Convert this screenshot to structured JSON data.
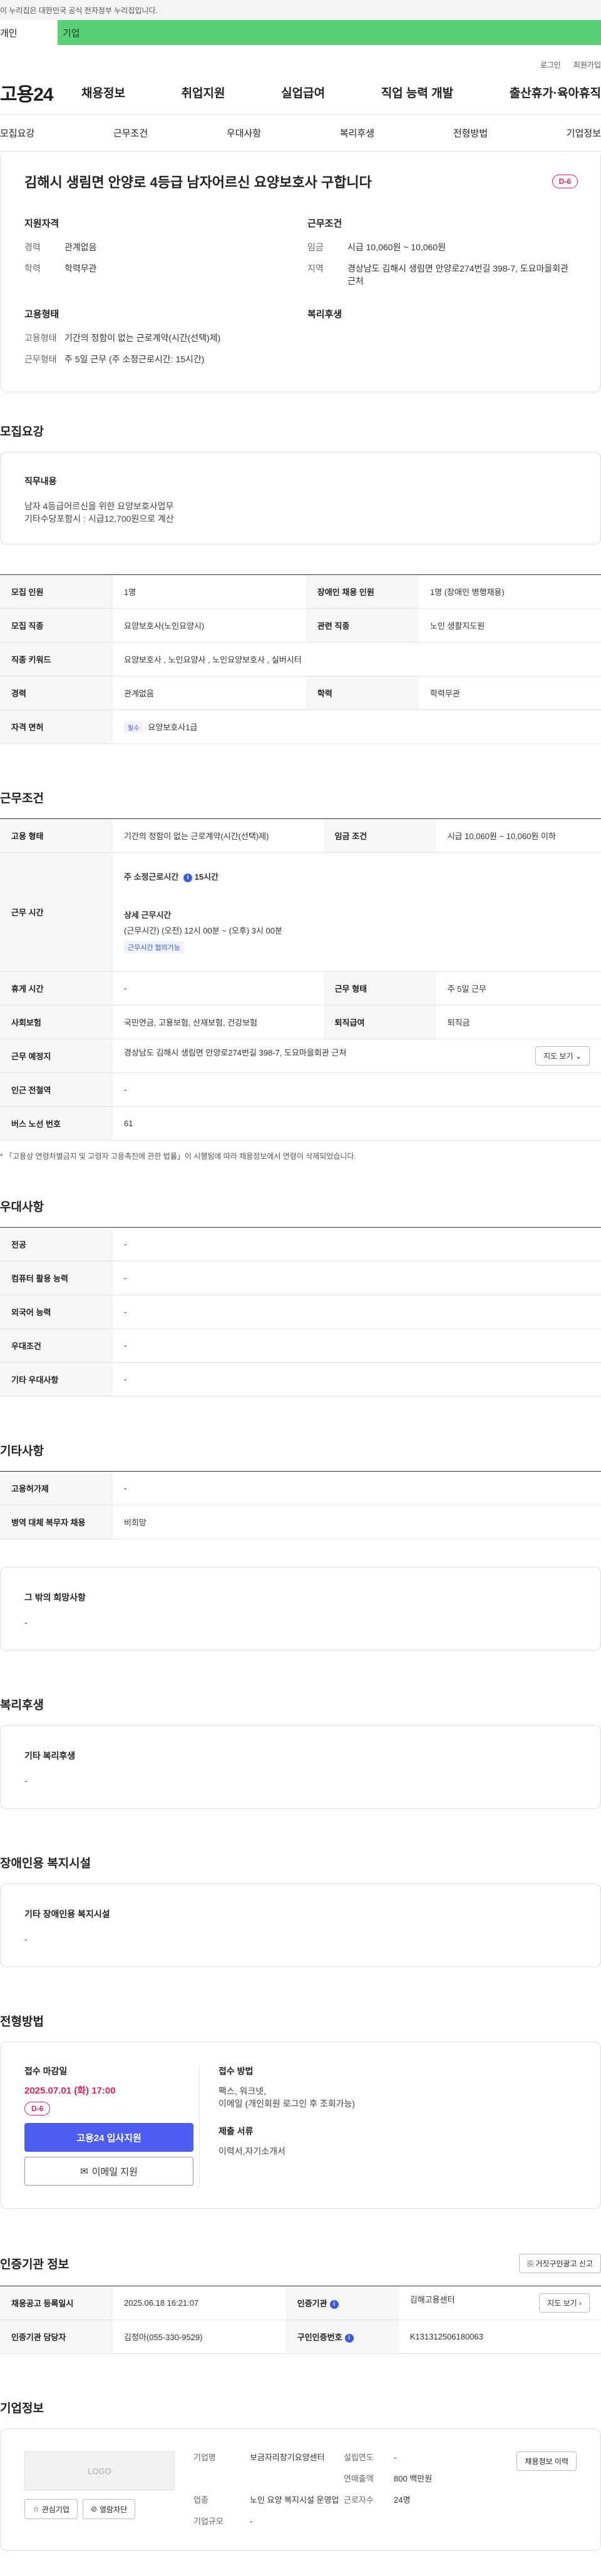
{
  "topbar": {
    "notice": "이 누리집은 대한민국 공식 전자정부 누리집입니다."
  },
  "userbar": {
    "personal": "개인",
    "company": "기업"
  },
  "utility": {
    "login": "로그인",
    "join": "회원가입"
  },
  "gnb": {
    "logo": "고용24",
    "menu": [
      "채용정보",
      "취업지원",
      "실업급여",
      "직업 능력 개발",
      "출산휴가·육아휴직"
    ]
  },
  "tabs": [
    "모집요강",
    "근무조건",
    "우대사항",
    "복리후생",
    "전형방법",
    "기업정보"
  ],
  "hero": {
    "title": "김해시 생림면 안양로 4등급 남자어르신 요양보호사 구합니다",
    "dday": "D-6",
    "qual_title": "지원자격",
    "career_k": "경력",
    "career_v": "관계없음",
    "edu_k": "학력",
    "edu_v": "학력무관",
    "emp_title": "고용형태",
    "emptype_k": "고용형태",
    "emptype_v": "기간의 정함이 없는 근로계약(시간(선택)제)",
    "worktype_k": "근무형태",
    "worktype_v": "주 5일 근무 (주 소정근로시간: 15시간)",
    "cond_title": "근무조건",
    "wage_k": "임금",
    "wage_v": "시급 10,060원 ~ 10,060원",
    "region_k": "지역",
    "region_v": "경상남도 김해시 생림면 안양로274번길 398-7, 도요마을회관 근처",
    "welfare_title": "복리후생"
  },
  "recruit": {
    "section_title": "모집요강",
    "duty_title": "직무내용",
    "duty_lines": [
      "남자 4등급어르신을 위한 요양보호사업무",
      "기타수당포함시 : 시급12,700원으로 계산"
    ],
    "rows": [
      {
        "k1": "모집 인원",
        "v1": "1명",
        "k2": "장애인 채용 인원",
        "v2": "1명 (장애인 병행채용)"
      },
      {
        "k1": "모집 직종",
        "v1": "요양보호사(노인요양시)",
        "k2": "관련 직종",
        "v2": "노인 생활지도원"
      },
      {
        "k1": "직종 키워드",
        "v1": "요양보호사 , 노인요양사 , 노인요양보호사 , 실버시터",
        "k2": "",
        "v2": ""
      },
      {
        "k1": "경력",
        "v1": "관계없음",
        "k2": "학력",
        "v2": "학력무관"
      },
      {
        "k1": "자격 면허",
        "v1": "요양보호사1급",
        "k2": "",
        "v2": ""
      }
    ],
    "license_tag": "필수"
  },
  "conditions": {
    "section_title": "근무조건",
    "emp_k": "고용 형태",
    "emp_v": "기간의 정함이 없는 근로계약(시간(선택)제)",
    "wage_k": "임금 조건",
    "wage_v": "시급 10,060원 ~ 10,060원 이하",
    "hours_k": "근무 시간",
    "hours_weekly": "주 소정근로시간",
    "hours_weekly_v": "15시간",
    "hours_detail_title": "상세 근무시간",
    "hours_detail_v": "(근무시간) (오전) 12시 00분 ~ (오후) 3시 00분",
    "hours_chip": "근무시간 협의가능",
    "rest_k": "휴게 시간",
    "rest_v": "-",
    "shape_k": "근무 형태",
    "shape_v": "주 5일 근무",
    "ins_k": "사회보험",
    "ins_v": "국민연금, 고용보험, 산재보험, 건강보험",
    "retire_k": "퇴직급여",
    "retire_v": "퇴직금",
    "place_k": "근무 예정지",
    "place_v": "경상남도 김해시 생림면 안양로274번길 398-7, 도요마을회관 근처",
    "map_btn": "지도 보기",
    "subway_k": "인근 전철역",
    "subway_v": "-",
    "bus_k": "버스 노선 번호",
    "bus_v": "61",
    "note": "* 「고용상 연령차별금지 및 고령자 고용촉진에 관한 법률」이 시행됨에 따라 채용정보에서 연령이 삭제되었습니다."
  },
  "preferences": {
    "section_title": "우대사항",
    "rows": [
      {
        "k": "전공",
        "v": "-"
      },
      {
        "k": "컴퓨터 활용 능력",
        "v": "-"
      },
      {
        "k": "외국어 능력",
        "v": "-"
      },
      {
        "k": "우대조건",
        "v": "-"
      },
      {
        "k": "기타 우대사항",
        "v": "-"
      }
    ]
  },
  "etc": {
    "section_title": "기타사항",
    "rows": [
      {
        "k": "고용허가제",
        "v": "-"
      },
      {
        "k": "병역 대체 복무자 채용",
        "v": "비희망"
      }
    ],
    "other_title": "그 밖의 희망사항",
    "other_v": "-"
  },
  "welfare": {
    "section_title": "복리후생",
    "box_title": "기타 복리후생",
    "box_v": "-"
  },
  "disability": {
    "section_title": "장애인용 복지시설",
    "box_title": "기타 장애인용 복지시설",
    "box_v": "-"
  },
  "selection": {
    "section_title": "전형방법",
    "deadline_title": "접수 마감일",
    "deadline_v": "2025.07.01 (화) 17:00",
    "dday": "D-6",
    "apply_btn": "고용24 입사지원",
    "email_btn": "이메일 지원",
    "method_title": "접수 방법",
    "method_v1": "팩스, 워크넷,",
    "method_v2": "이메일 (개인회원 로그인 후 조회가능)",
    "docs_title": "제출 서류",
    "docs_v": "이력서,자기소개서"
  },
  "agency": {
    "section_title": "인증기관 정보",
    "report_btn": "거짓구인광고 신고",
    "reg_k": "채용공고 등록일시",
    "reg_v": "2025.06.18 16:21:07",
    "org_k": "인증기관",
    "org_v": "김해고용센터",
    "more_btn": "지도 보기",
    "mgr_k": "인증기관 담당자",
    "mgr_v": "김정아(055-330-9529)",
    "id_k": "구인인증번호",
    "id_v": "K131312506180063"
  },
  "company": {
    "section_title": "기업정보",
    "logo_text": "LOGO",
    "fav_btn": "관심기업",
    "block_btn": "열람차단",
    "name_k": "기업명",
    "name_v": "보금자리장기요양센터",
    "year_k": "설립연도",
    "year_v": "-",
    "sales_k": "연매출액",
    "sales_v": "800 백만원",
    "industry_k": "업종",
    "industry_v": "노인 요양 복지시설 운영업",
    "staff_k": "근로자수",
    "staff_v": "24명",
    "size_k": "기업규모",
    "size_v": "-",
    "history_btn": "채용정보 이력"
  }
}
